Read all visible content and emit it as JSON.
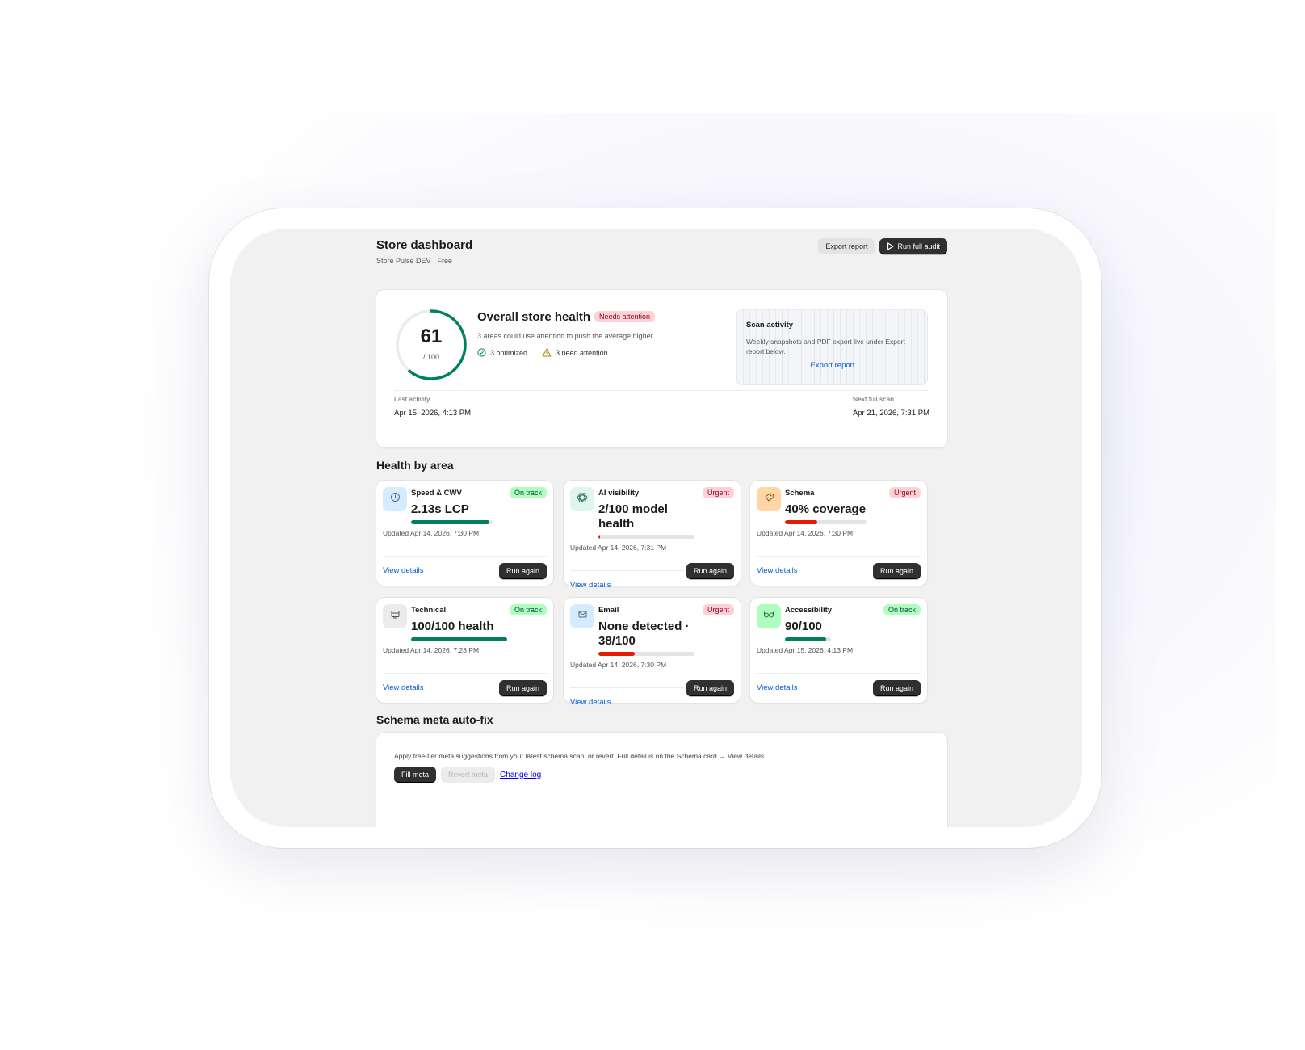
{
  "header": {
    "title": "Store dashboard",
    "subtitle": "Store Pulse DEV · Free",
    "export_label": "Export report",
    "run_label": "Run full audit",
    "run_icon": "play-icon"
  },
  "overall": {
    "score": "61",
    "score_value": 61,
    "score_max": "/ 100",
    "title": "Overall store health",
    "badge": "Needs attention",
    "description": "3 areas could use attention to push the average higher.",
    "optimized_label": "3 optimized",
    "attention_label": "3 need attention",
    "last_activity_label": "Last activity",
    "last_activity_value": "Apr 15, 2026, 4:13 PM",
    "next_scan_label": "Next full scan",
    "next_scan_value": "Apr 21, 2026, 7:31 PM",
    "colors": {
      "gauge": "#008060",
      "track": "#ebebeb"
    }
  },
  "scan_activity": {
    "title": "Scan activity",
    "description": "Weekly snapshots and PDF export live under Export report below.",
    "link": "Export report"
  },
  "areas_section": {
    "title": "Health by area"
  },
  "areas": [
    {
      "name": "Speed & CWV",
      "badge": "On track",
      "status": "ok",
      "metric": "2.13s LCP",
      "progress": 0.96,
      "updated": "Updated Apr 14, 2026, 7:30 PM",
      "link": "View details",
      "button": "Run again",
      "icon": "clock-icon",
      "icon_bg": "#d5ebff",
      "bar_color": "#008060"
    },
    {
      "name": "AI visibility",
      "badge": "Urgent",
      "status": "urgent",
      "metric": "2/100 model health",
      "progress": 0.02,
      "updated": "Updated Apr 14, 2026, 7:31 PM",
      "link": "View details",
      "button": "Run again",
      "icon": "openai-icon",
      "icon_bg": "#e1f5ef",
      "bar_color": "#e51c00"
    },
    {
      "name": "Schema",
      "badge": "Urgent",
      "status": "urgent",
      "metric": "40% coverage",
      "progress": 0.4,
      "updated": "Updated Apr 14, 2026, 7:30 PM",
      "link": "View details",
      "button": "Run again",
      "icon": "tag-icon",
      "icon_bg": "#ffd6a4",
      "bar_color": "#e51c00"
    },
    {
      "name": "Technical",
      "badge": "On track",
      "status": "ok",
      "metric": "100/100 health",
      "progress": 1.0,
      "updated": "Updated Apr 14, 2026, 7:28 PM",
      "link": "View details",
      "button": "Run again",
      "icon": "server-icon",
      "icon_bg": "#ebebeb",
      "bar_color": "#008060"
    },
    {
      "name": "Email",
      "badge": "Urgent",
      "status": "urgent",
      "metric": "None detected · 38/100",
      "progress": 0.38,
      "updated": "Updated Apr 14, 2026, 7:30 PM",
      "link": "View details",
      "button": "Run again",
      "icon": "email-icon",
      "icon_bg": "#d5ebff",
      "bar_color": "#e51c00"
    },
    {
      "name": "Accessibility",
      "badge": "On track",
      "status": "ok",
      "metric": "90/100",
      "progress": 0.9,
      "updated": "Updated Apr 15, 2026, 4:13 PM",
      "link": "View details",
      "button": "Run again",
      "icon": "glasses-icon",
      "icon_bg": "#affebf",
      "bar_color": "#008060"
    }
  ],
  "autofix": {
    "title": "Schema meta auto-fix",
    "description": "Apply free-tier meta suggestions from your latest schema scan, or revert. Full detail is on the Schema card → View details.",
    "fill_label": "Fill meta",
    "revert_label": "Revert meta",
    "changelog_label": "Change log"
  }
}
